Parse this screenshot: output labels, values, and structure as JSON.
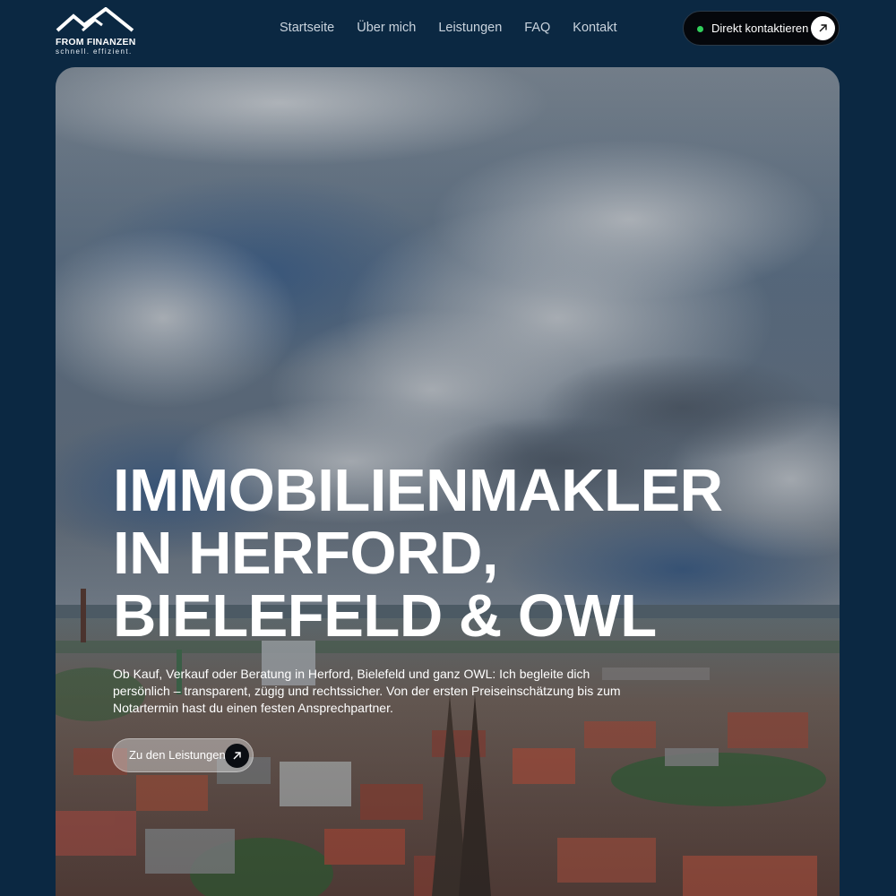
{
  "brand": {
    "name": "FROM FINANZEN",
    "tagline": "schnell. effizient.",
    "logo_icon": "mountain-logo"
  },
  "nav": {
    "items": [
      {
        "label": "Startseite"
      },
      {
        "label": "Über mich"
      },
      {
        "label": "Leistungen"
      },
      {
        "label": "FAQ"
      },
      {
        "label": "Kontakt"
      }
    ]
  },
  "cta": {
    "label": "Direkt kontaktieren",
    "status_color": "#31d05b",
    "icon": "arrow-up-right-icon"
  },
  "hero": {
    "title_lines": [
      "IMMOBILIENMAKLER",
      "IN HERFORD,",
      "BIELEFELD & OWL"
    ],
    "description": "Ob Kauf, Verkauf oder Beratung in Herford, Bielefeld und ganz OWL: Ich begleite dich persönlich – transparent, zügig und rechtssicher. Von der ersten Preiseinschätzung bis zum Notartermin hast du einen festen Ansprechpartner.",
    "button_label": "Zu den Leistungen",
    "button_icon": "arrow-up-right-icon",
    "background_image": "city-skyline-photo"
  },
  "colors": {
    "page_background": "#0b2842",
    "accent_dark": "#05070b"
  }
}
